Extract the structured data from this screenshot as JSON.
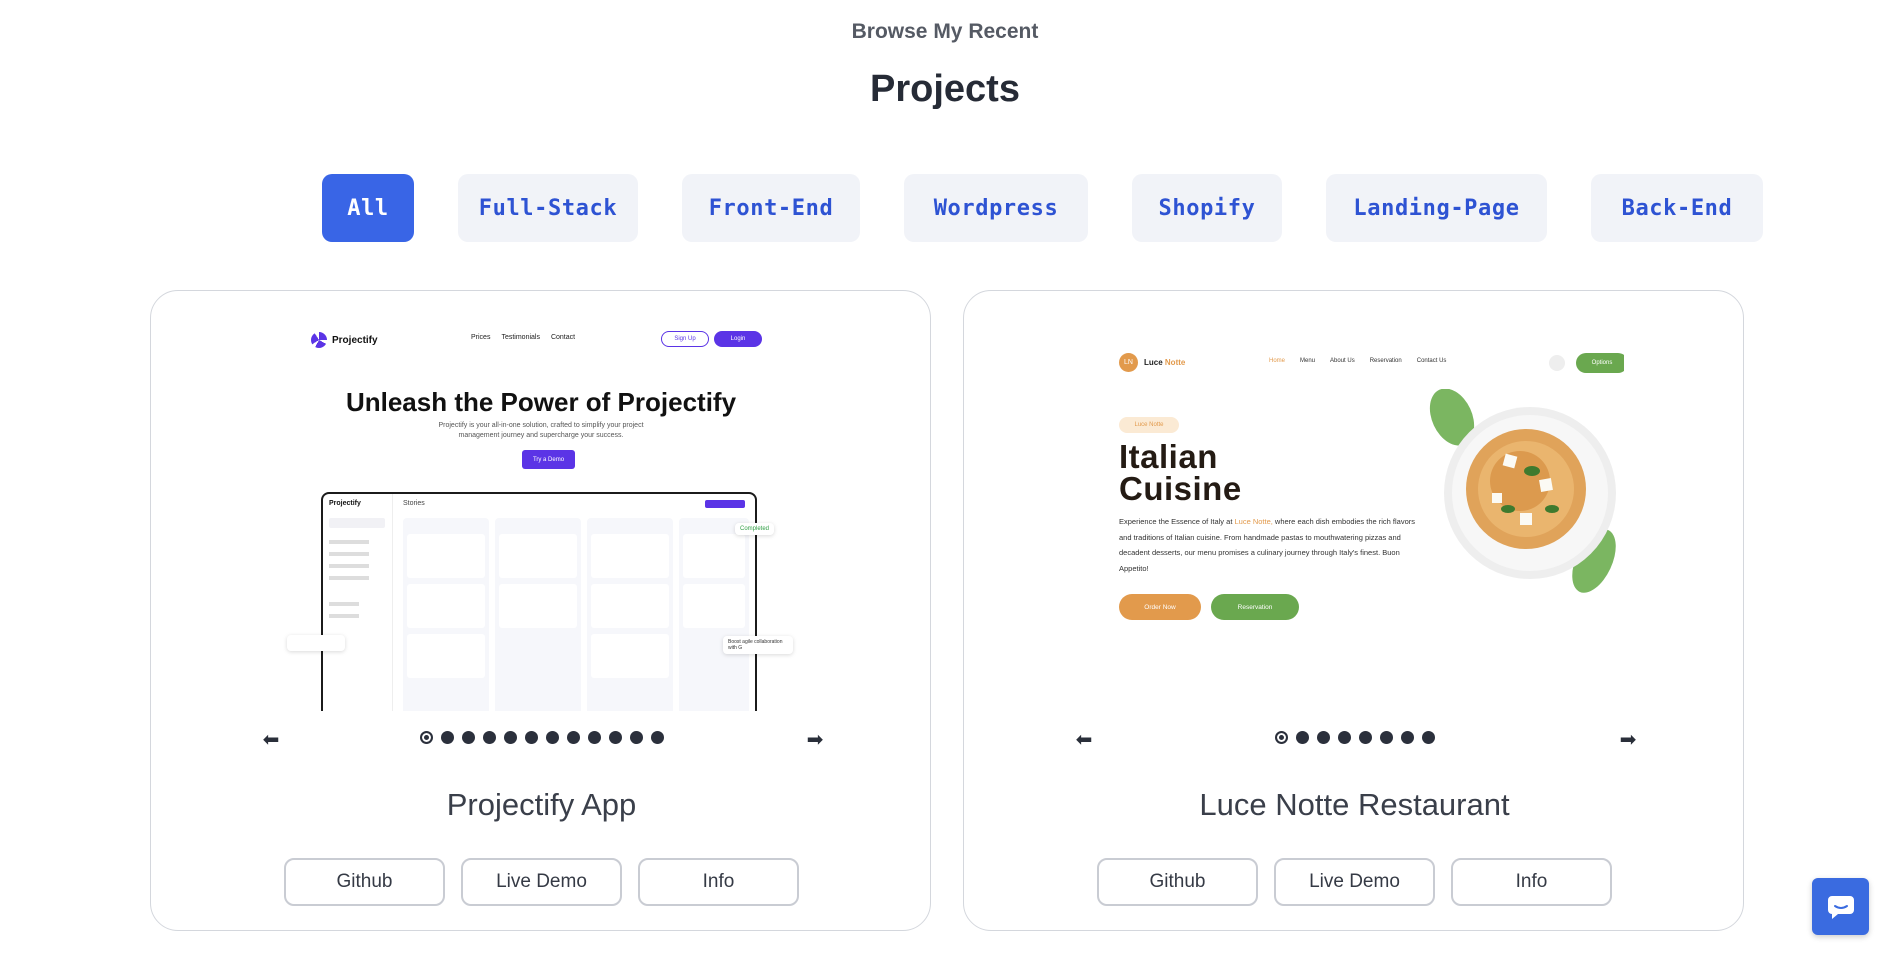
{
  "header": {
    "eyebrow": "Browse My Recent",
    "title": "Projects"
  },
  "filters": [
    "All",
    "Full-Stack",
    "Front-End",
    "Wordpress",
    "Shopify",
    "Landing-Page",
    "Back-End"
  ],
  "active_filter": "All",
  "projects": [
    {
      "title": "Projectify App",
      "slide_count": 12,
      "current_slide": 1,
      "buttons": {
        "github": "Github",
        "demo": "Live Demo",
        "info": "Info"
      },
      "preview": {
        "logo": "Projectify",
        "nav": [
          "Prices",
          "Testimonials",
          "Contact"
        ],
        "signup": "Sign Up",
        "login": "Login",
        "hero": "Unleash the Power of Projectify",
        "subtitle": "Projectify is your all-in-one solution, crafted to simplify your project management journey and supercharge your success.",
        "cta": "Try a Demo",
        "app_title": "Stories",
        "completed_chip": "Completed",
        "google_chip": "Boost agile collaboration with G"
      }
    },
    {
      "title": "Luce Notte Restaurant",
      "slide_count": 8,
      "current_slide": 1,
      "buttons": {
        "github": "Github",
        "demo": "Live Demo",
        "info": "Info"
      },
      "preview": {
        "badge": "LN",
        "name_main": "Luce",
        "name_accent": "Notte",
        "nav": [
          "Home",
          "Menu",
          "About Us",
          "Reservation",
          "Contact Us"
        ],
        "options": "Options",
        "pill": "Luce Notte",
        "hero_line1": "Italian",
        "hero_line2": "Cuisine",
        "text_before": "Experience the Essence of Italy at ",
        "text_accent": "Luce Notte,",
        "text_after": " where each dish embodies the rich flavors and traditions of Italian cuisine. From handmade pastas to mouthwatering pizzas and decadent desserts, our menu promises a culinary journey through Italy's finest. Buon Appetito!",
        "order": "Order Now",
        "reservation": "Reservation"
      }
    }
  ],
  "colors": {
    "accent": "#3965e6",
    "filter_text": "#2e53d3",
    "filter_bg": "#f1f3f8",
    "projectify_purple": "#5b34e6",
    "luce_orange": "#e29a4c",
    "luce_green": "#6aa84f"
  }
}
